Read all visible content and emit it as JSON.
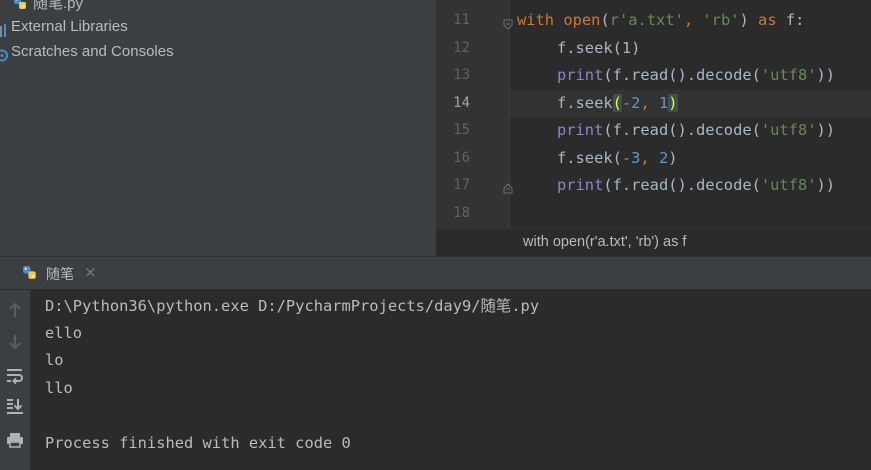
{
  "project_tree": {
    "items": [
      {
        "label": "随笔.py",
        "icon": "python-file-icon"
      },
      {
        "label": "External Libraries",
        "icon": "libraries-icon"
      },
      {
        "label": "Scratches and Consoles",
        "icon": "scratches-icon"
      }
    ]
  },
  "editor": {
    "line_numbers": [
      "11",
      "12",
      "13",
      "14",
      "15",
      "16",
      "17",
      "18"
    ],
    "active_line": "14",
    "lines": {
      "l11": {
        "kw_with": "with",
        "sp1": " ",
        "fn_open": "open",
        "p1": "(",
        "str1": "r'a.txt'",
        "comma": ", ",
        "str2": "'rb'",
        "p2": ")",
        "sp2": " ",
        "kw_as": "as",
        "var": " f:"
      },
      "l12": {
        "code": "f.seek(1)"
      },
      "l13": {
        "fn_print": "print",
        "mid": "(f.read().decode(",
        "str": "'utf8'",
        "end": "))"
      },
      "l14": {
        "pre": "f.seek",
        "open_paren": "(",
        "num1": "-2",
        "comma": ", ",
        "num2": "1",
        "close_paren": ")"
      },
      "l15": {
        "fn_print": "print",
        "mid": "(f.read().decode(",
        "str": "'utf8'",
        "end": "))"
      },
      "l16": {
        "pre": "f.seek(",
        "num1": "-3",
        "comma": ", ",
        "num2": "2",
        "end": ")"
      },
      "l17": {
        "fn_print": "print",
        "mid": "(f.read().decode(",
        "str": "'utf8'",
        "end": "))"
      }
    },
    "breadcrumb": "with open(r'a.txt', 'rb') as f"
  },
  "run_panel": {
    "tab_label": "随笔",
    "tab_close": "×",
    "console_lines": [
      "D:\\Python36\\python.exe D:/PycharmProjects/day9/随笔.py",
      "ello",
      "lo",
      "llo",
      "",
      "Process finished with exit code 0"
    ],
    "toolbar_icons": [
      "up-arrow-icon",
      "down-arrow-icon",
      "soft-wrap-icon",
      "scroll-to-end-icon",
      "print-icon"
    ]
  },
  "colors": {
    "keyword": "#cc7832",
    "builtin": "#8888c6",
    "string": "#6a8759",
    "number": "#6897bb",
    "text": "#a9b7c6",
    "bracket_highlight": "#ffef28"
  }
}
